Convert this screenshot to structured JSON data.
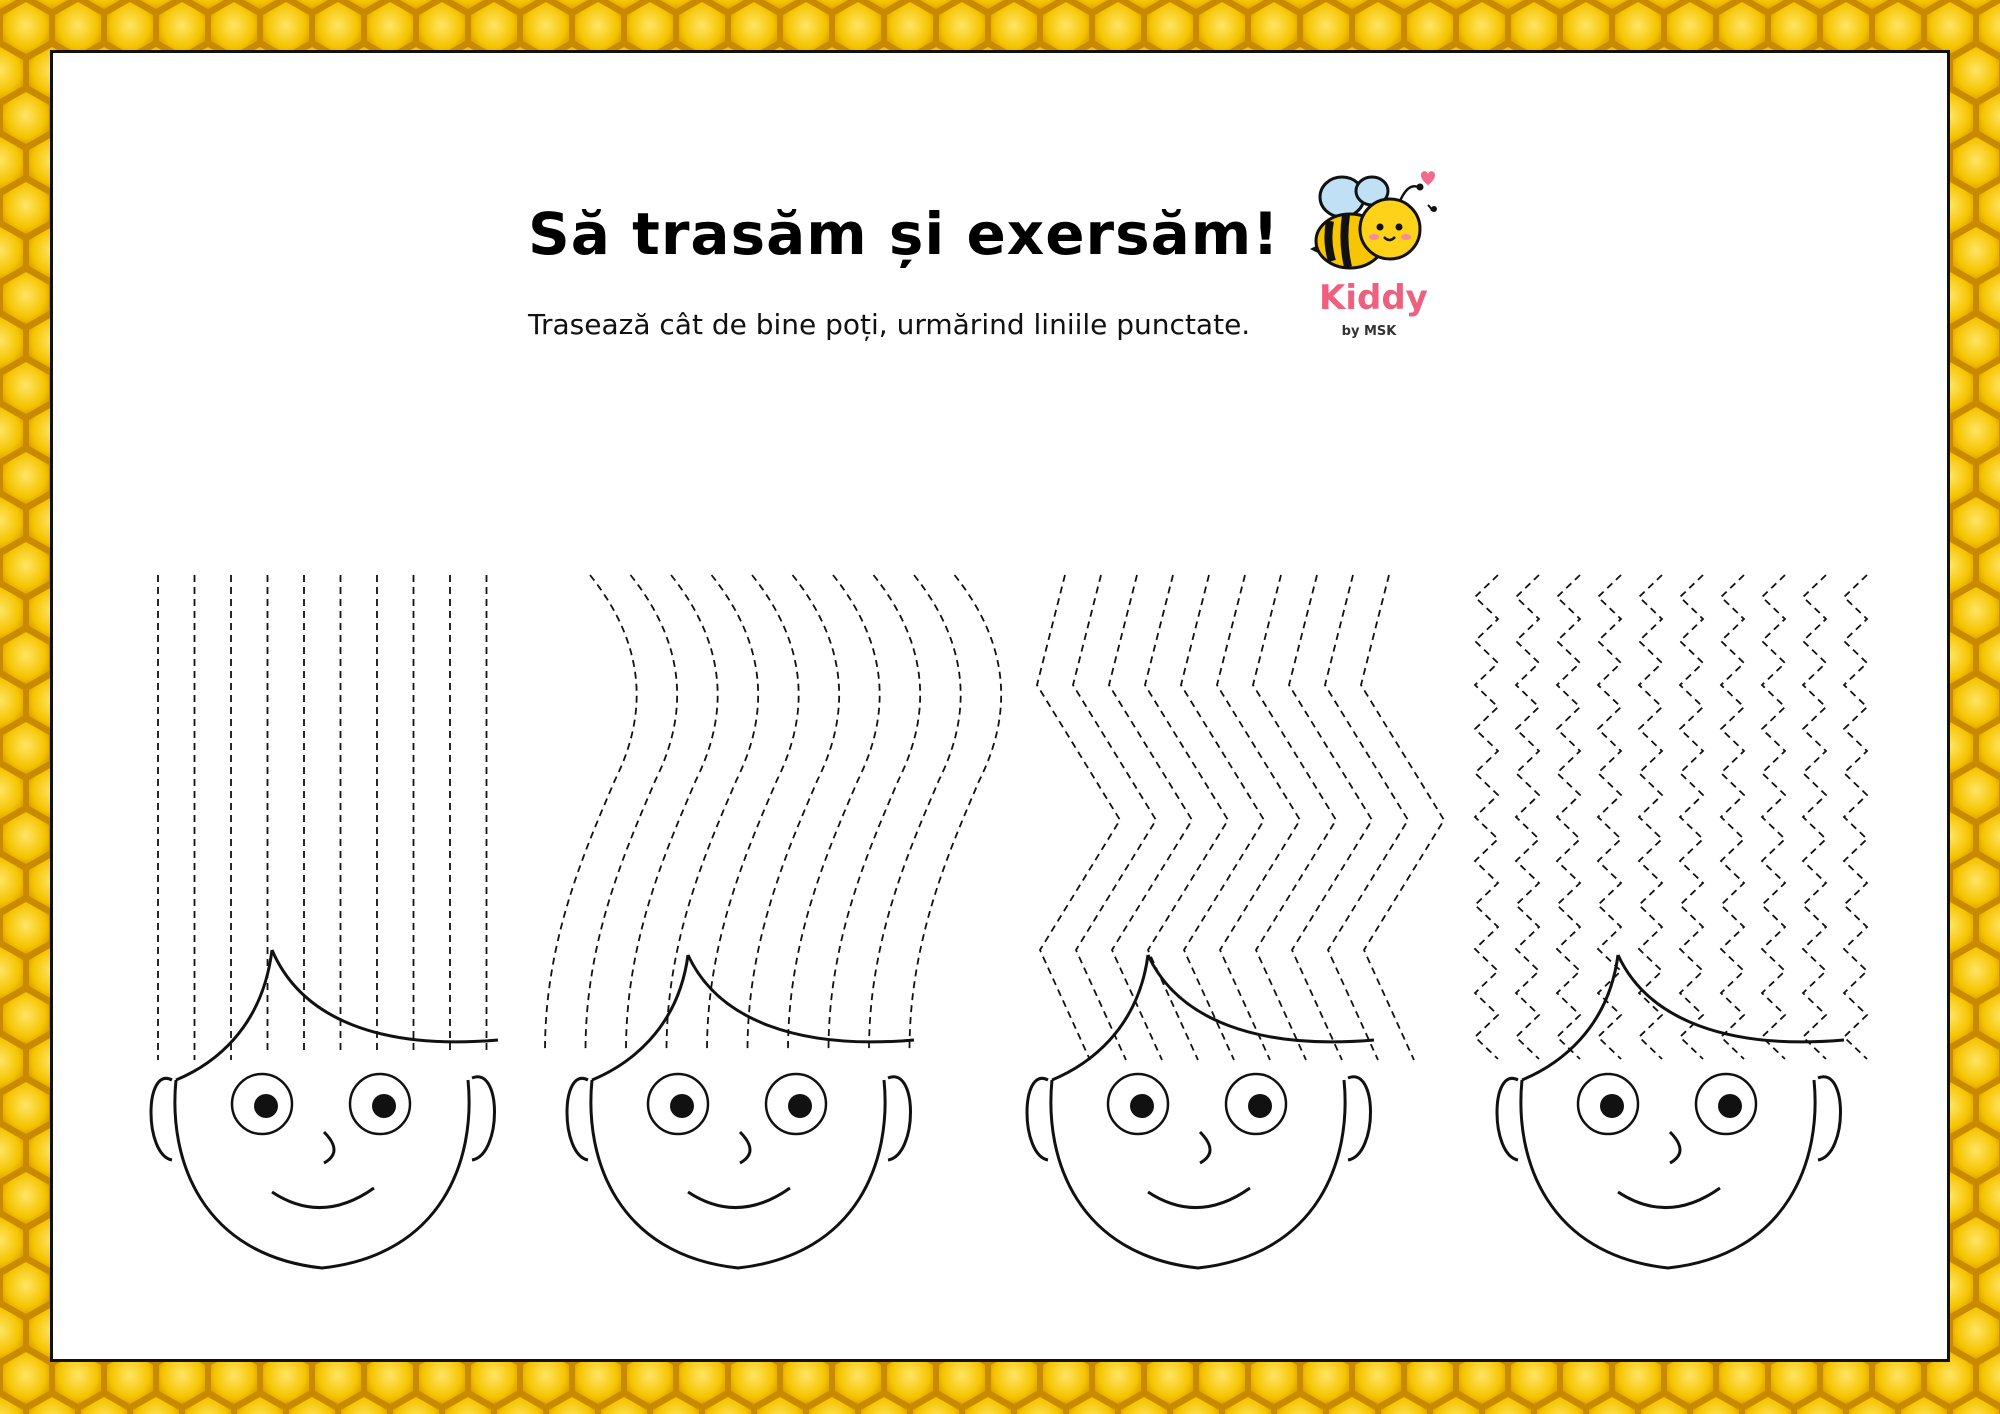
{
  "worksheet": {
    "title": "Să trasăm și exersăm!",
    "subtitle": "Trasează cât de bine poți, urmărind liniile punctate.",
    "logo": {
      "brand": "Kiddy",
      "tagline": "by MSK",
      "mascot_icon": "bee-icon",
      "brand_color": "#ef5f7e"
    },
    "border": {
      "pattern": "honeycomb",
      "color": "#f2c200"
    },
    "exercises": [
      {
        "hair_line_style": "straight-vertical",
        "line_count": 10
      },
      {
        "hair_line_style": "wavy-curved",
        "line_count": 10
      },
      {
        "hair_line_style": "zigzag-large",
        "line_count": 10
      },
      {
        "hair_line_style": "zigzag-small",
        "line_count": 10
      }
    ]
  }
}
